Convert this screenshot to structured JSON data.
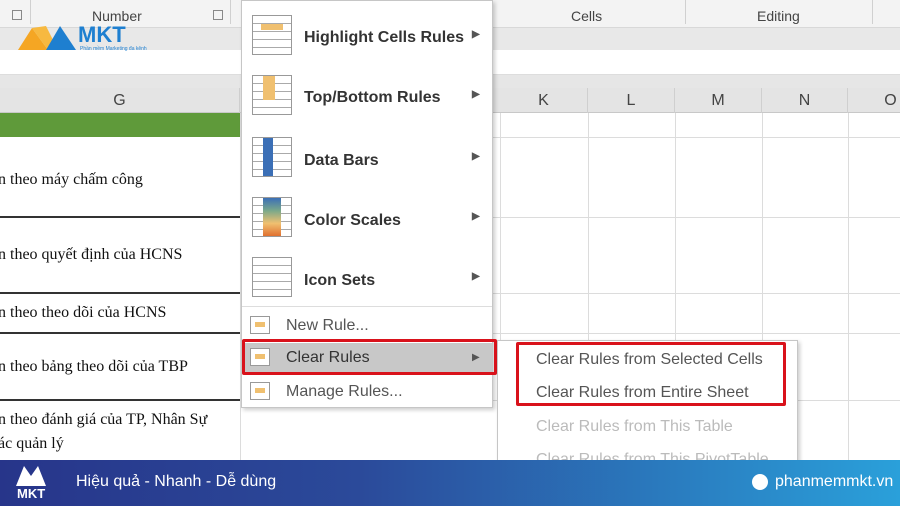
{
  "ribbon": {
    "groups": [
      "Number",
      "Cells",
      "Editing"
    ]
  },
  "logo": {
    "text": "MKT",
    "tagline": "Phần mềm Marketing đa kênh"
  },
  "columns": [
    "G",
    "K",
    "L",
    "M",
    "N",
    "O"
  ],
  "cells": [
    {
      "line1": "n theo máy chấm công"
    },
    {
      "line1": "n theo quyết định của HCNS"
    },
    {
      "line1": "n theo theo dõi của HCNS"
    },
    {
      "line1": "n theo bảng theo dõi của TBP"
    },
    {
      "line1": "n theo đánh giá của TP, Nhân Sự",
      "line2": "ác quản lý"
    }
  ],
  "menu": {
    "items": [
      {
        "label": "Highlight Cells Rules",
        "key": "H",
        "icon": "highlight-cells-icon"
      },
      {
        "label": "Top/Bottom Rules",
        "key": "T",
        "icon": "top-bottom-icon"
      },
      {
        "label": "Data Bars",
        "key": "D",
        "icon": "data-bars-icon"
      },
      {
        "label": "Color Scales",
        "key": "S",
        "icon": "color-scales-icon"
      },
      {
        "label": "Icon Sets",
        "key": "I",
        "icon": "icon-sets-icon"
      }
    ],
    "small_items": [
      {
        "label": "New Rule...",
        "key": "N"
      },
      {
        "label": "Clear Rules",
        "key": "C",
        "selected": true
      },
      {
        "label": "Manage Rules...",
        "key": "R"
      }
    ]
  },
  "submenu": {
    "items": [
      {
        "label": "Clear Rules from Selected Cells",
        "enabled": true
      },
      {
        "label": "Clear Rules from Entire Sheet",
        "enabled": true
      },
      {
        "label": "Clear Rules from This Table",
        "enabled": false
      },
      {
        "label": "Clear Rules from This PivotTable",
        "enabled": false
      }
    ]
  },
  "footer": {
    "logo": "MKT",
    "slogan": "Hiệu quả - Nhanh  - Dễ dùng",
    "website": "phanmemmkt.vn"
  },
  "colors": {
    "highlight_box": "#d9121b",
    "header_green": "#5f9a3a",
    "footer_start": "#27358a",
    "footer_end": "#2aa0da"
  }
}
